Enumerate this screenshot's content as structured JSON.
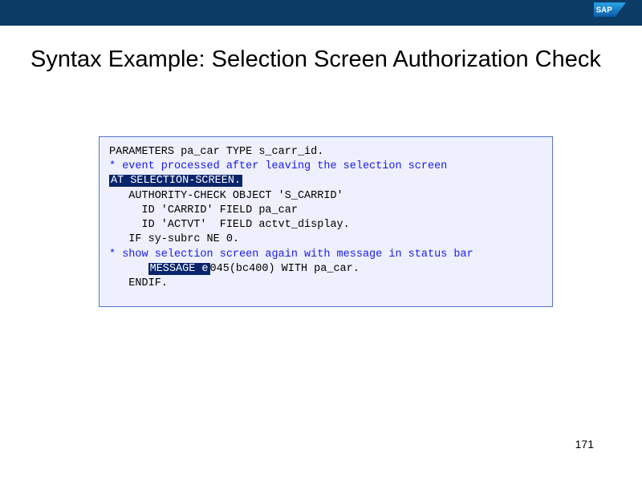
{
  "brand": {
    "logo_text": "SAP"
  },
  "slide": {
    "title": "Syntax Example: Selection Screen Authorization Check",
    "page_number": "171"
  },
  "code": {
    "l1": "PARAMETERS pa_car TYPE s_carr_id.",
    "l2": "",
    "l3": "* event processed after leaving the selection screen",
    "l4_hl": "AT SELECTION-SCREEN.",
    "l5": "   AUTHORITY-CHECK OBJECT 'S_CARRID'",
    "l6": "     ID 'CARRID' FIELD pa_car",
    "l7": "     ID 'ACTVT'  FIELD actvt_display.",
    "l8": "   IF sy-subrc NE 0.",
    "l9": "* show selection screen again with message in status bar",
    "l10_indent": "      ",
    "l10_hl": "MESSAGE e",
    "l10_rest": "045(bc400) WITH pa_car.",
    "l11": "   ENDIF."
  }
}
